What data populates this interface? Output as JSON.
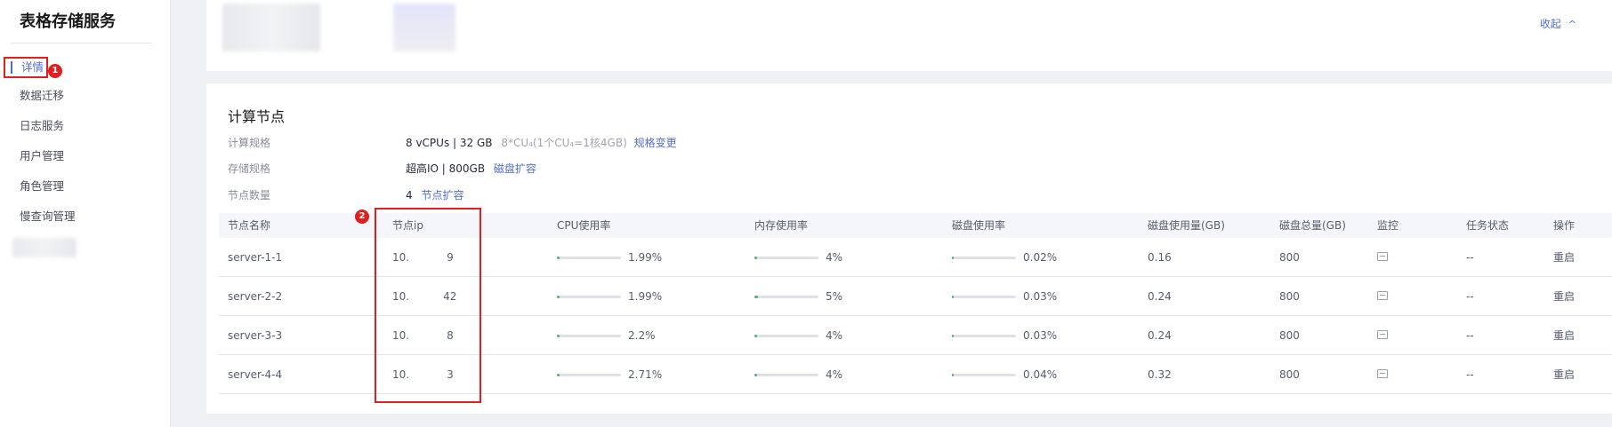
{
  "sidebar": {
    "title": "表格存储服务",
    "items": [
      {
        "label": "详情",
        "active": true
      },
      {
        "label": "数据迁移"
      },
      {
        "label": "日志服务"
      },
      {
        "label": "用户管理"
      },
      {
        "label": "角色管理"
      },
      {
        "label": "慢查询管理"
      }
    ]
  },
  "annotations": {
    "badge1": "1",
    "badge2": "2"
  },
  "top_card": {
    "collapse_label": "收起",
    "collapse_icon": "chevron-up-icon"
  },
  "compute": {
    "title": "计算节点",
    "spec_label": "计算规格",
    "spec_value": "8 vCPUs | 32 GB",
    "spec_hint": "8*CU₄(1个CU₄=1核4GB)",
    "spec_change": "规格变更",
    "storage_label": "存储规格",
    "storage_value": "超高IO | 800GB",
    "storage_expand": "磁盘扩容",
    "count_label": "节点数量",
    "count_value": "4",
    "count_expand": "节点扩容"
  },
  "table": {
    "columns": [
      "节点名称",
      "节点ip",
      "CPU使用率",
      "内存使用率",
      "磁盘使用率",
      "磁盘使用量(GB)",
      "磁盘总量(GB)",
      "监控",
      "任务状态",
      "操作"
    ],
    "rows": [
      {
        "name": "server-1-1",
        "ip_prefix": "10.",
        "ip_suffix": "9",
        "cpu": "1.99%",
        "cpu_frac": 0.04,
        "mem": "4%",
        "mem_frac": 0.04,
        "disk": "0.02%",
        "disk_frac": 0.0,
        "disk_used": "0.16",
        "disk_total": "800",
        "task": "--",
        "action": "重启"
      },
      {
        "name": "server-2-2",
        "ip_prefix": "10.",
        "ip_suffix": "42",
        "cpu": "1.99%",
        "cpu_frac": 0.04,
        "mem": "5%",
        "mem_frac": 0.05,
        "disk": "0.03%",
        "disk_frac": 0.0,
        "disk_used": "0.24",
        "disk_total": "800",
        "task": "--",
        "action": "重启"
      },
      {
        "name": "server-3-3",
        "ip_prefix": "10.",
        "ip_suffix": "8",
        "cpu": "2.2%",
        "cpu_frac": 0.04,
        "mem": "4%",
        "mem_frac": 0.04,
        "disk": "0.03%",
        "disk_frac": 0.0,
        "disk_used": "0.24",
        "disk_total": "800",
        "task": "--",
        "action": "重启"
      },
      {
        "name": "server-4-4",
        "ip_prefix": "10.",
        "ip_suffix": "3",
        "cpu": "2.71%",
        "cpu_frac": 0.04,
        "mem": "4%",
        "mem_frac": 0.04,
        "disk": "0.04%",
        "disk_frac": 0.0,
        "disk_used": "0.32",
        "disk_total": "800",
        "task": "--",
        "action": "重启"
      }
    ]
  },
  "colors": {
    "accent": "#526ecc",
    "annotation": "#e02020",
    "bar_fill": "#50b371"
  }
}
